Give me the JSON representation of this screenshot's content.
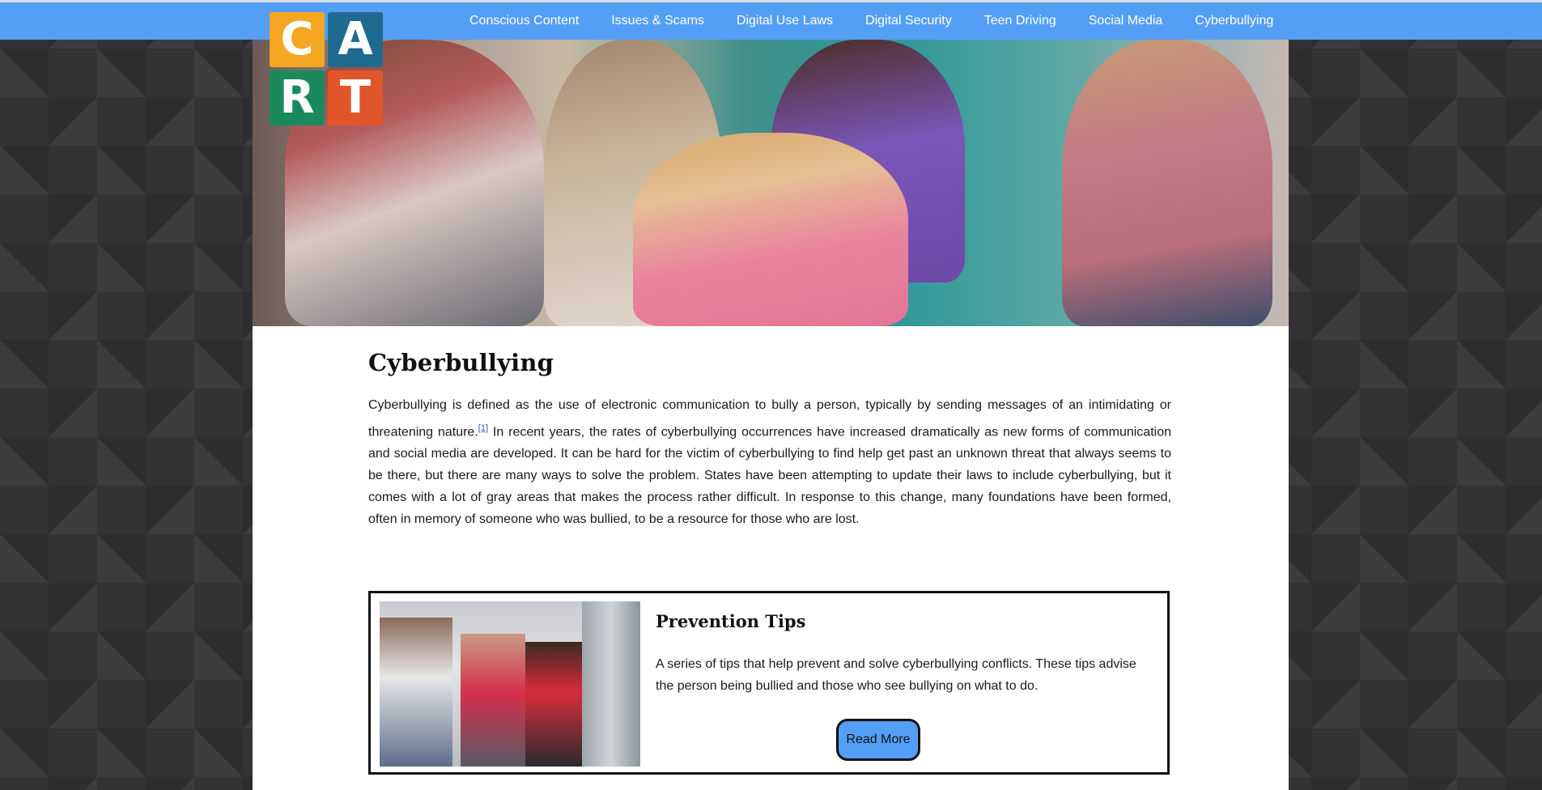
{
  "nav": {
    "items": [
      {
        "label": "Conscious Content"
      },
      {
        "label": "Issues & Scams"
      },
      {
        "label": "Digital Use Laws"
      },
      {
        "label": "Digital Security"
      },
      {
        "label": "Teen Driving"
      },
      {
        "label": "Social Media"
      },
      {
        "label": "Cyberbullying"
      }
    ]
  },
  "logo": {
    "letters": [
      "C",
      "A",
      "R",
      "T"
    ],
    "colors": [
      "#f5a623",
      "#1f6b8f",
      "#1a8a5e",
      "#e0562a"
    ]
  },
  "hero": {
    "image": "children-sitting-sad-girl-photo"
  },
  "main": {
    "title": "Cyberbullying",
    "intro_part1": "Cyberbullying is defined as the use of electronic communication to bully a person, typically by sending messages of an intimidating or threatening nature.",
    "footnote": "[1]",
    "intro_part2": " In recent years, the rates of cyberbullying occurrences have increased dramatically as new forms of communication and social media are developed. It can be hard for the victim of cyberbullying to find help get past an unknown threat that always seems to be there, but there are many ways to solve the problem. States have been attempting to update their laws to include cyberbullying, but it comes with a lot of gray areas that makes the process rather difficult. In response to this change, many foundations have been formed, often in memory of someone who was bullied, to be a resource for those who are lost."
  },
  "card": {
    "title": "Prevention Tips",
    "description": "A series of tips that help prevent and solve cyberbullying conflicts. These tips advise the person being bullied and those who see bullying on what to do.",
    "button_label": "Read More",
    "image": "students-at-lockers-photo"
  },
  "colors": {
    "nav_bg": "#549ef6",
    "button_bg": "#549ef6",
    "page_bg": "#333335"
  }
}
